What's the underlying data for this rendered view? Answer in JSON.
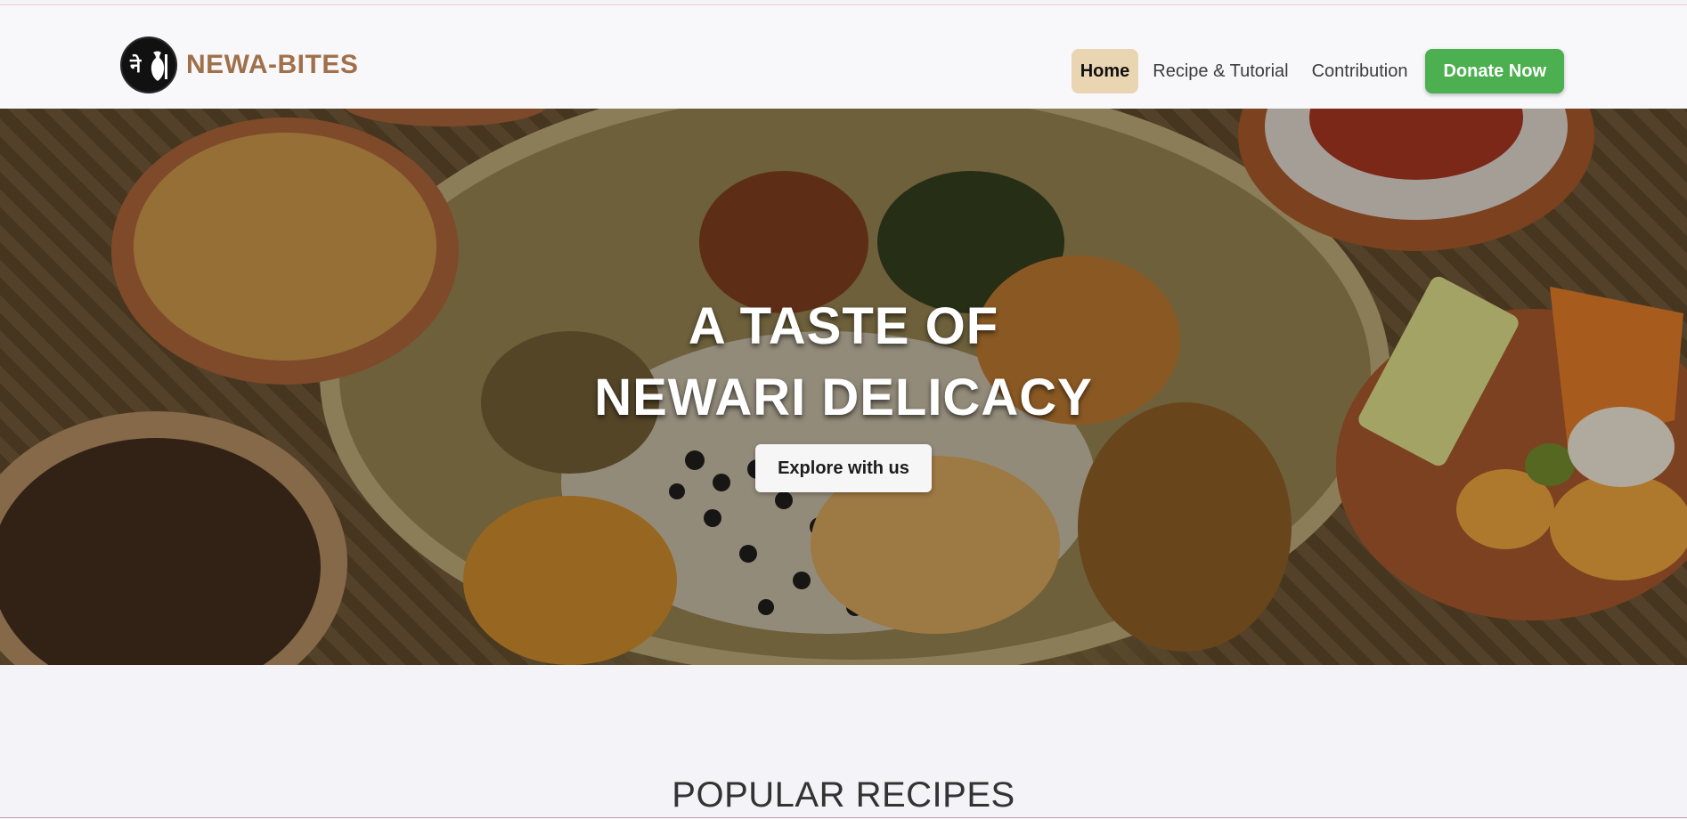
{
  "brand": {
    "logo_glyph": "नेवा",
    "name": "NEWA-BITES",
    "color": "#a0704a"
  },
  "nav": {
    "items": [
      {
        "label": "Home",
        "active": true
      },
      {
        "label": "Recipe & Tutorial",
        "active": false
      },
      {
        "label": "Contribution",
        "active": false
      }
    ],
    "donate_label": "Donate Now",
    "donate_color": "#4caf50",
    "active_color": "#ead5b3"
  },
  "hero": {
    "title_line1": "A TASTE OF",
    "title_line2": "NEWARI DELICACY",
    "cta_label": "Explore with us"
  },
  "popular": {
    "heading": "POPULAR RECIPES"
  }
}
